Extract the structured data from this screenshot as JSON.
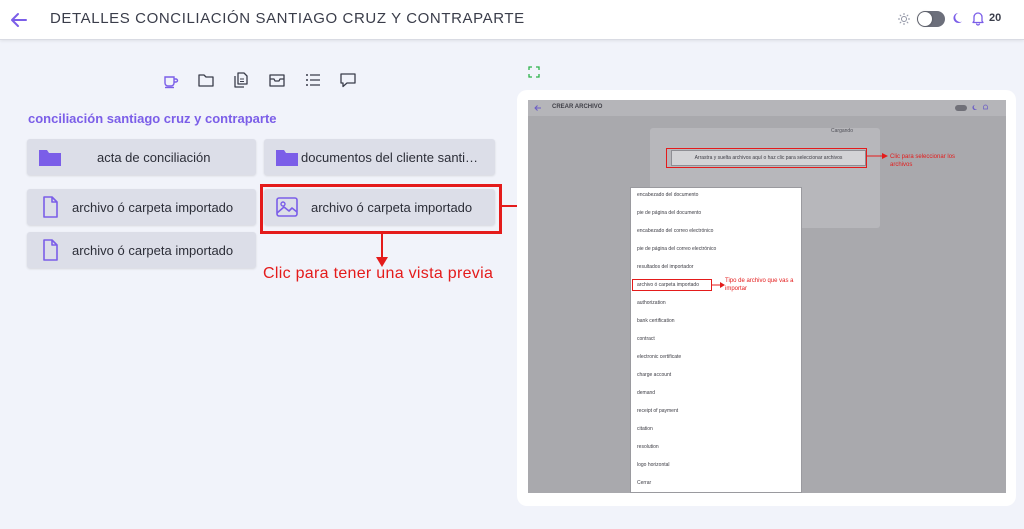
{
  "header": {
    "title": "DETALLES CONCILIACIÓN SANTIAGO CRUZ Y CONTRAPARTE",
    "notification_count": "20"
  },
  "toolbar": {
    "icons": [
      "coffee-cup-icon",
      "folder-icon",
      "copy-files-icon",
      "inbox-archive-icon",
      "list-icon",
      "comment-icon"
    ]
  },
  "folder_path": "conciliación santiago cruz y contraparte",
  "items": [
    {
      "label": "acta de conciliación",
      "icon": "folder-icon"
    },
    {
      "label": "documentos del cliente santiago cruz",
      "icon": "folder-icon"
    },
    {
      "label": "archivo ó carpeta importado",
      "icon": "file-icon"
    },
    {
      "label": "archivo ó carpeta importado",
      "icon": "image-icon"
    },
    {
      "label": "archivo ó carpeta importado",
      "icon": "file-icon"
    }
  ],
  "annotations": {
    "preview_hint": "Clic para tener una vista previa",
    "select_files_hint": "Clic para seleccionar los archivos",
    "file_type_hint": "Tipo de archivo que vas a importar"
  },
  "preview": {
    "title": "CREAR ARCHIVO",
    "upload_label": "Cargando",
    "drop_text": "Arrastra y suelta archivos aquí o haz clic para seleccionar archivos",
    "menu_items": [
      "encabezado del documento",
      "pie de página del documento",
      "encabezado del correo electrónico",
      "pie de página del correo electrónico",
      "resultados del importador",
      "archivo ó carpeta importado",
      "authorization",
      "bank certification",
      "contract",
      "electronic certificate",
      "charge account",
      "demand",
      "receipt of payment",
      "citation",
      "resolution",
      "logo horizontal",
      "Cerrar"
    ]
  },
  "colors": {
    "accent": "#7b5ee8",
    "annotation_red": "#e41b1b",
    "background": "#f1f3fa",
    "card": "#dcdee8"
  }
}
